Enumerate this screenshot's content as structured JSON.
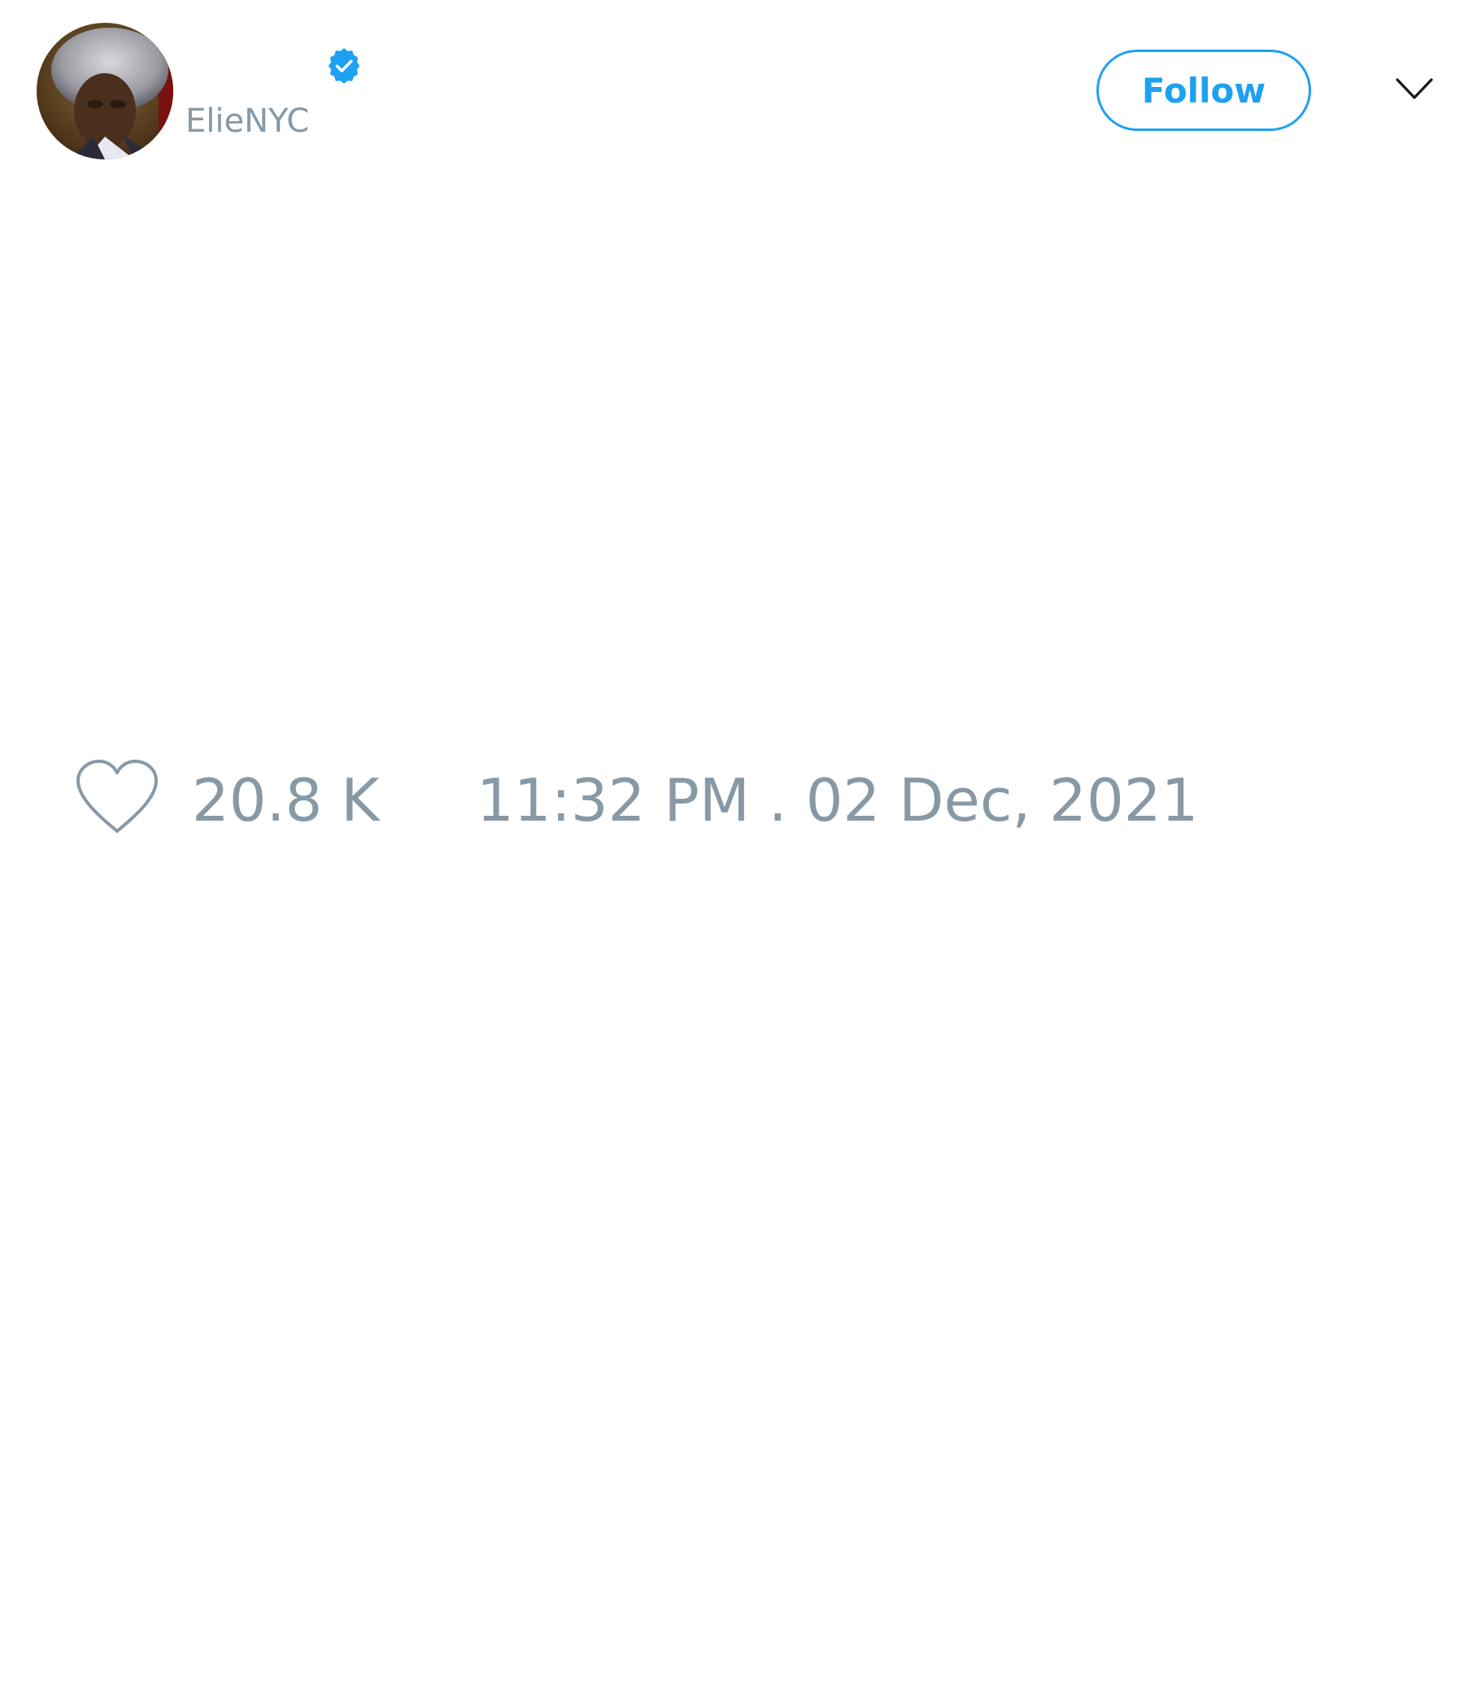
{
  "author": {
    "display_name": "",
    "handle": "ElieNYC",
    "verified": true,
    "avatar_icon": "profile-photo"
  },
  "actions": {
    "follow_label": "Follow",
    "more_icon": "chevron-down-icon"
  },
  "tweet": {
    "like_icon": "heart-outline-icon",
    "like_count": "20.8 K",
    "timestamp": "11:32 PM . 02 Dec, 2021"
  },
  "colors": {
    "accent": "#1da1f2",
    "muted_text": "#8899a6",
    "background": "#ffffff"
  }
}
